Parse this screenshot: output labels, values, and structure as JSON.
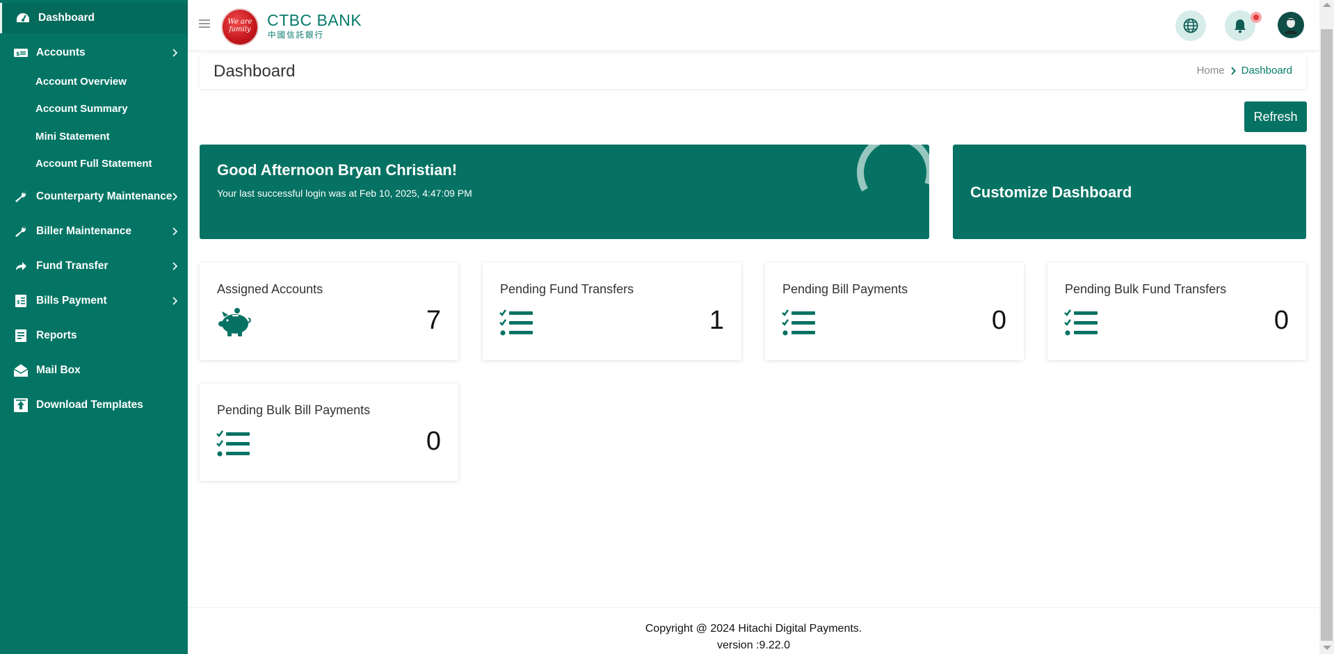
{
  "sidebar": {
    "items": [
      {
        "label": "Dashboard",
        "icon": "dashboard-gauge-icon",
        "has_submenu": false,
        "active": true
      },
      {
        "label": "Accounts",
        "icon": "money-bill-icon",
        "has_submenu": true,
        "expanded": true,
        "subitems": [
          "Account Overview",
          "Account Summary",
          "Mini Statement",
          "Account Full Statement"
        ]
      },
      {
        "label": "Counterparty Maintenance",
        "icon": "wrench-icon",
        "has_submenu": true
      },
      {
        "label": "Biller Maintenance",
        "icon": "wrench-icon",
        "has_submenu": true
      },
      {
        "label": "Fund Transfer",
        "icon": "share-arrow-icon",
        "has_submenu": true
      },
      {
        "label": "Bills Payment",
        "icon": "bill-document-icon",
        "has_submenu": true
      },
      {
        "label": "Reports",
        "icon": "report-icon",
        "has_submenu": false
      },
      {
        "label": "Mail Box",
        "icon": "envelope-open-icon",
        "has_submenu": false
      },
      {
        "label": "Download Templates",
        "icon": "upload-box-icon",
        "has_submenu": false
      }
    ]
  },
  "header": {
    "logo_text": "We are family",
    "brand_name": "CTBC BANK",
    "brand_subtitle": "中國信託銀行",
    "icons": [
      "menu-icon",
      "globe-icon",
      "bell-icon",
      "user-avatar-icon"
    ]
  },
  "page": {
    "title": "Dashboard",
    "breadcrumb": {
      "home": "Home",
      "current": "Dashboard"
    },
    "refresh_label": "Refresh"
  },
  "greeting": {
    "title": "Good Afternoon Bryan Christian!",
    "last_login": "Your last successful login was at Feb 10, 2025, 4:47:09 PM"
  },
  "customize_label": "Customize Dashboard",
  "stats": [
    {
      "title": "Assigned Accounts",
      "value": "7",
      "icon": "piggy-bank-icon"
    },
    {
      "title": "Pending Fund Transfers",
      "value": "1",
      "icon": "checklist-icon"
    },
    {
      "title": "Pending Bill Payments",
      "value": "0",
      "icon": "checklist-icon"
    },
    {
      "title": "Pending Bulk Fund Transfers",
      "value": "0",
      "icon": "checklist-icon"
    },
    {
      "title": "Pending Bulk Bill Payments",
      "value": "0",
      "icon": "checklist-icon"
    }
  ],
  "footer": {
    "copyright": "Copyright @ 2024 Hitachi Digital Payments.",
    "version": "version :9.22.0"
  },
  "colors": {
    "brand_green": "#047565",
    "card_green": "#067263",
    "notification_red": "#e0393c"
  }
}
